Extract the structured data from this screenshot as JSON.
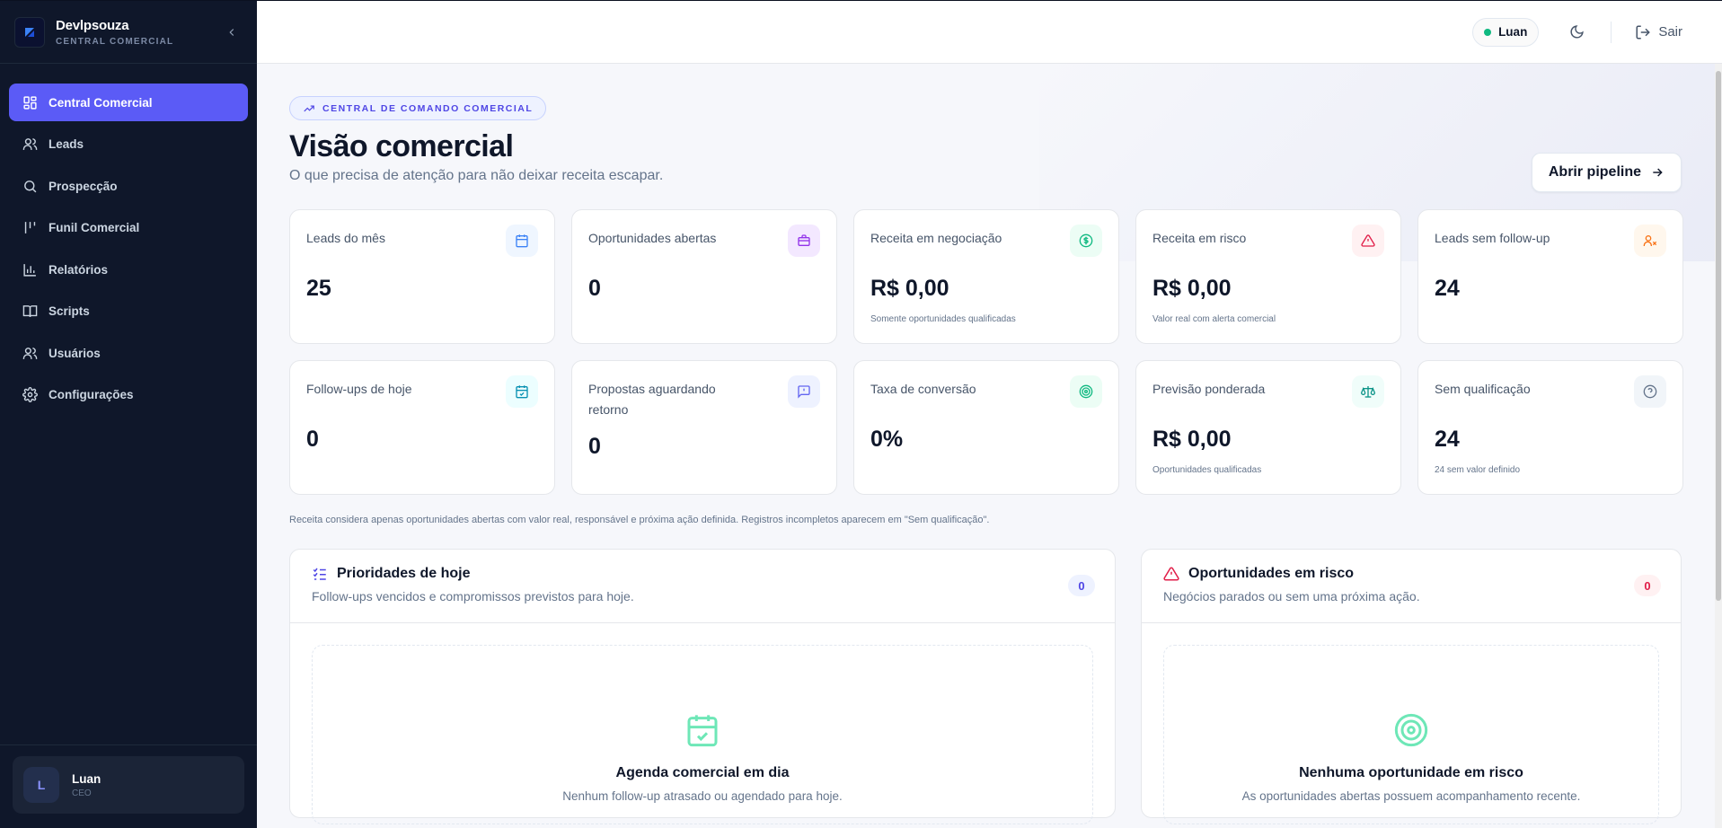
{
  "brand": {
    "name": "Devlpsouza",
    "subtitle": "CENTRAL COMERCIAL"
  },
  "sidebar": {
    "items": [
      {
        "label": "Central Comercial",
        "icon": "dashboard-icon",
        "active": true
      },
      {
        "label": "Leads",
        "icon": "users-icon"
      },
      {
        "label": "Prospecção",
        "icon": "search-icon"
      },
      {
        "label": "Funil Comercial",
        "icon": "kanban-icon"
      },
      {
        "label": "Relatórios",
        "icon": "bar-chart-icon"
      },
      {
        "label": "Scripts",
        "icon": "book-icon"
      },
      {
        "label": "Usuários",
        "icon": "users-icon"
      },
      {
        "label": "Configurações",
        "icon": "gear-icon"
      }
    ],
    "user": {
      "initial": "L",
      "name": "Luan",
      "role": "CEO"
    }
  },
  "topbar": {
    "user_label": "Luan",
    "logout_label": "Sair"
  },
  "header": {
    "tag": "CENTRAL DE COMANDO COMERCIAL",
    "title": "Visão comercial",
    "subtitle": "O que precisa de atenção para não deixar receita escapar.",
    "pipeline_button": "Abrir pipeline"
  },
  "cards": [
    {
      "label": "Leads do mês",
      "value": "25",
      "note": "",
      "icon": "calendar-icon"
    },
    {
      "label": "Oportunidades abertas",
      "value": "0",
      "note": "",
      "icon": "briefcase-icon"
    },
    {
      "label": "Receita em negociação",
      "value": "R$ 0,00",
      "note": "Somente oportunidades qualificadas",
      "icon": "dollar-icon"
    },
    {
      "label": "Receita em risco",
      "value": "R$ 0,00",
      "note": "Valor real com alerta comercial",
      "icon": "alert-triangle-icon"
    },
    {
      "label": "Leads sem follow-up",
      "value": "24",
      "note": "",
      "icon": "user-x-icon"
    },
    {
      "label": "Follow-ups de hoje",
      "value": "0",
      "note": "",
      "icon": "calendar-check-icon"
    },
    {
      "label": "Propostas aguardando retorno",
      "value": "0",
      "note": "",
      "icon": "message-alert-icon"
    },
    {
      "label": "Taxa de conversão",
      "value": "0%",
      "note": "",
      "icon": "target-icon"
    },
    {
      "label": "Previsão ponderada",
      "value": "R$ 0,00",
      "note": "Oportunidades qualificadas",
      "icon": "scale-icon"
    },
    {
      "label": "Sem qualificação",
      "value": "24",
      "note": "24 sem valor definido",
      "icon": "help-circle-icon"
    }
  ],
  "footnote": "Receita considera apenas oportunidades abertas com valor real, responsável e próxima ação definida. Registros incompletos aparecem em \"Sem qualificação\".",
  "panels": {
    "priorities": {
      "title": "Prioridades de hoje",
      "subtitle": "Follow-ups vencidos e compromissos previstos para hoje.",
      "count": "0",
      "empty_title": "Agenda comercial em dia",
      "empty_subtitle": "Nenhum follow-up atrasado ou agendado para hoje."
    },
    "risk": {
      "title": "Oportunidades em risco",
      "subtitle": "Negócios parados ou sem uma próxima ação.",
      "count": "0",
      "empty_title": "Nenhuma oportunidade em risco",
      "empty_subtitle": "As oportunidades abertas possuem acompanhamento recente."
    }
  },
  "colors": {
    "accent": "#5b5bf6",
    "sidebar_bg": "#0f172a",
    "success": "#10b981",
    "danger": "#e11d48"
  }
}
